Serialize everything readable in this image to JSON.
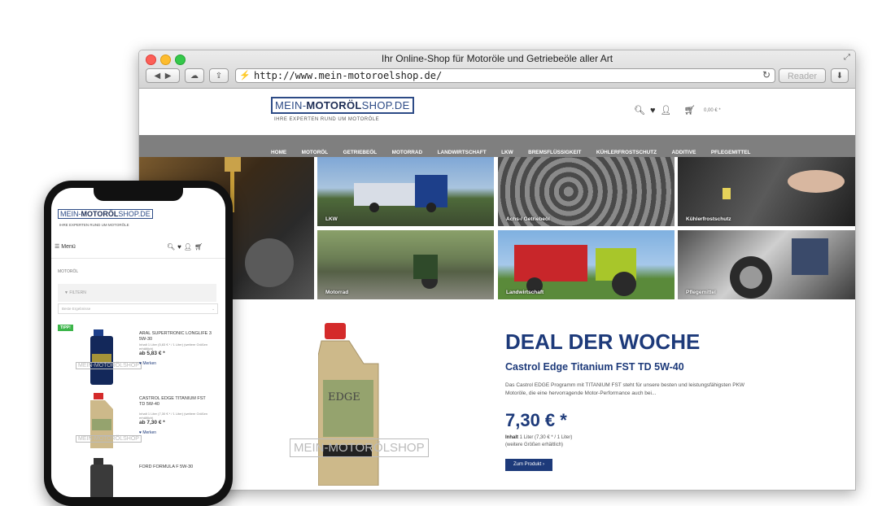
{
  "browser": {
    "window_title": "Ihr Online-Shop für Motoröle und Getriebeöle aller Art",
    "url": "http://www.mein-motoroelshop.de/",
    "reader_label": "Reader",
    "back_icon": "back-arrow-icon",
    "forward_icon": "forward-arrow-icon"
  },
  "site": {
    "logo_prefix": "MEIN-",
    "logo_bold": "MOTORÖL",
    "logo_suffix": "SHOP.DE",
    "tagline": "IHRE EXPERTEN RUND UM MOTORÖLE",
    "cart_total": "0,00 € *",
    "nav": [
      "HOME",
      "MOTORÖL",
      "GETRIEBEÖL",
      "MOTORRAD",
      "LANDWIRTSCHAFT",
      "LKW",
      "BREMSFLÜSSIGKEIT",
      "KÜHLERFROSTSCHUTZ",
      "ADDITIVE",
      "PFLEGEMITTEL"
    ],
    "tiles": [
      "LKW",
      "Achs-/ Getriebeöl",
      "Kühlerfrostschutz",
      "Motorrad",
      "Landwirtschaft",
      "Pflegemittel"
    ]
  },
  "deal": {
    "heading": "DEAL DER WOCHE",
    "product": "Castrol Edge Titanium FST TD 5W-40",
    "description": "Das Castrol EDGE Programm mit TITANIUM FST steht für unsere besten und leistungsfähigsten PKW Motoröle, die eine hervorragende Motor-Performance auch bei...",
    "price": "7,30 € *",
    "content_label": "Inhalt",
    "content_value": "1 Liter (7,30 € * / 1 Liter)",
    "sizes_note": "(weitere Größen erhältlich)",
    "button": "Zum Produkt",
    "watermark": "MEIN-MOTORÖLSHOP"
  },
  "mobile": {
    "menu_label": "Menü",
    "breadcrumb": "MOTORÖL",
    "filter_label": "FILTERN",
    "sort_label": "Beste Ergebnisse",
    "merken": "Merken",
    "watermark": "MEIN-MOTORÖLSHOP",
    "products": [
      {
        "badge": "TIPP!",
        "name": "ARAL SUPERTRONIC LONGLIFE 3 5W-30",
        "unit": "Inhalt 1 Liter (5,83 € * / 1 Liter) (weitere Größen erhältlich)",
        "price": "ab 5,83 € *"
      },
      {
        "badge": "",
        "name": "CASTROL EDGE TITANIUM FST TD 5W-40",
        "unit": "Inhalt 1 Liter (7,30 € * / 1 Liter) (weitere Größen erhältlich)",
        "price": "ab 7,30 € *"
      },
      {
        "badge": "",
        "name": "FORD FORMULA F 5W-30",
        "unit": "",
        "price": ""
      }
    ]
  }
}
